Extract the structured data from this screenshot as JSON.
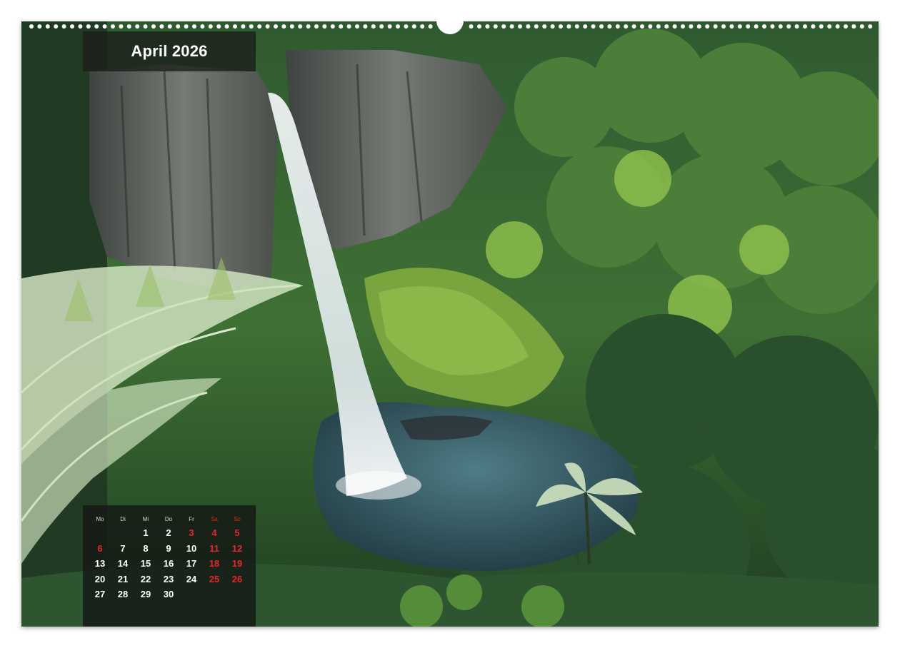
{
  "calendar": {
    "month_title": "April 2026",
    "weekdays": [
      "Mo",
      "Di",
      "Mi",
      "Do",
      "Fr",
      "Sa",
      "So"
    ],
    "weekend_color": "#e8262a",
    "weeks": [
      [
        "",
        "",
        "1",
        "2",
        "3",
        "4",
        "5"
      ],
      [
        "6",
        "7",
        "8",
        "9",
        "10",
        "11",
        "12"
      ],
      [
        "13",
        "14",
        "15",
        "16",
        "17",
        "18",
        "19"
      ],
      [
        "20",
        "21",
        "22",
        "23",
        "24",
        "25",
        "26"
      ],
      [
        "27",
        "28",
        "29",
        "30",
        "",
        "",
        ""
      ]
    ],
    "red_days": [
      "3",
      "4",
      "5",
      "6",
      "11",
      "12",
      "18",
      "19",
      "25",
      "26"
    ]
  },
  "photo": {
    "subject": "waterfall-in-rainforest",
    "colors": {
      "forest_dark": "#1f3a22",
      "forest_mid": "#3f6b34",
      "forest_light": "#7fb04a",
      "cliff": "#5b5f5a",
      "water": "#3a6470",
      "fern": "#d6e8c8"
    }
  }
}
